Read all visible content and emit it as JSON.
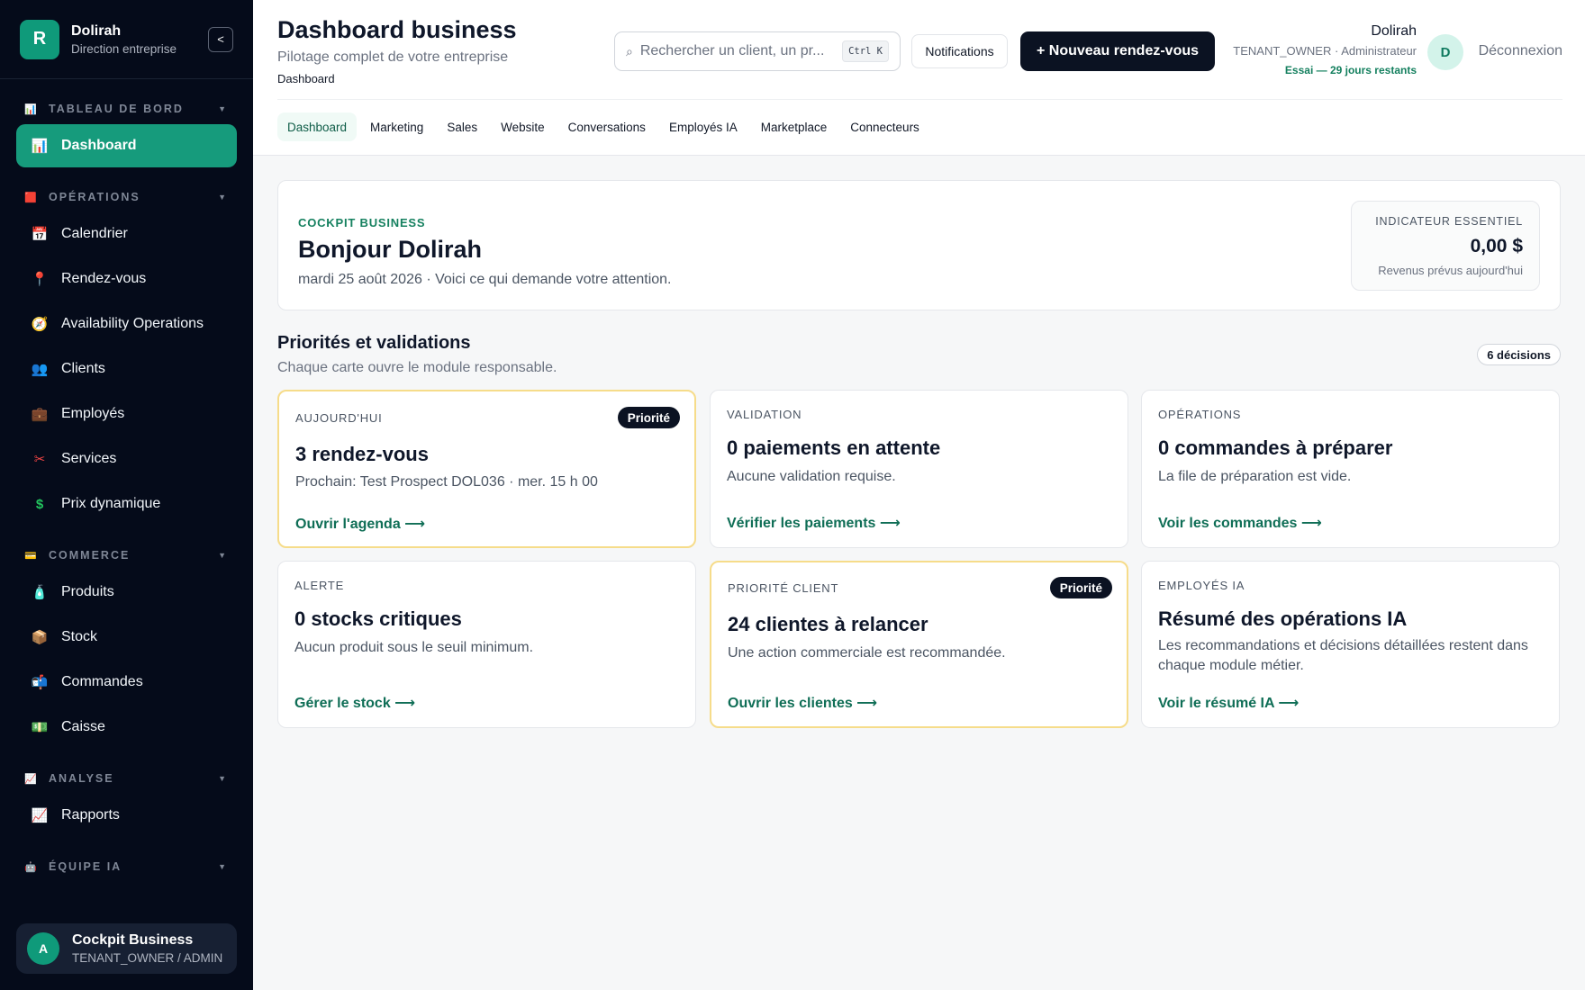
{
  "sidebar": {
    "brand": {
      "initial": "R",
      "name": "Dolirah",
      "subtitle": "Direction entreprise",
      "collapse": "<"
    },
    "sections": {
      "tableau": {
        "label": "TABLEAU DE BORD",
        "icon": "📊"
      },
      "operations": {
        "label": "OPÉRATIONS",
        "icon": "🟥"
      },
      "commerce": {
        "label": "COMMERCE",
        "icon": "💳"
      },
      "analyse": {
        "label": "ANALYSE",
        "icon": "📈"
      },
      "equipe": {
        "label": "ÉQUIPE IA",
        "icon": "🤖"
      }
    },
    "items": [
      {
        "label": "Dashboard",
        "icon": "📊"
      },
      {
        "label": "Calendrier",
        "icon": "📅"
      },
      {
        "label": "Rendez-vous",
        "icon": "📍"
      },
      {
        "label": "Availability Operations",
        "icon": "🧭"
      },
      {
        "label": "Clients",
        "icon": "👥"
      },
      {
        "label": "Employés",
        "icon": "💼"
      },
      {
        "label": "Services",
        "icon": "✂"
      },
      {
        "label": "Prix dynamique",
        "icon": "$"
      },
      {
        "label": "Produits",
        "icon": "🧴"
      },
      {
        "label": "Stock",
        "icon": "📦"
      },
      {
        "label": "Commandes",
        "icon": "📬"
      },
      {
        "label": "Caisse",
        "icon": "💵"
      },
      {
        "label": "Rapports",
        "icon": "📈"
      }
    ],
    "user": {
      "initial": "A",
      "name": "Cockpit Business",
      "role": "TENANT_OWNER / ADMIN"
    }
  },
  "header": {
    "title": "Dashboard business",
    "subtitle": "Pilotage complet de votre entreprise",
    "breadcrumb": "Dashboard",
    "search_placeholder": "Rechercher un client, un pr...",
    "search_shortcut": "Ctrl K",
    "notifications": "Notifications",
    "new_appointment": "+ Nouveau rendez-vous",
    "account": {
      "name": "Dolirah",
      "role": "TENANT_OWNER · Administrateur",
      "trial": "Essai — 29 jours restants",
      "initial": "D"
    },
    "logout": "Déconnexion",
    "tabs": [
      "Dashboard",
      "Marketing",
      "Sales",
      "Website",
      "Conversations",
      "Employés IA",
      "Marketplace",
      "Connecteurs"
    ]
  },
  "hero": {
    "tag": "COCKPIT BUSINESS",
    "title": "Bonjour Dolirah",
    "subtitle": "mardi 25 août 2026 · Voici ce qui demande votre attention.",
    "kpi": {
      "label": "INDICATEUR ESSENTIEL",
      "value": "0,00 $",
      "sub": "Revenus prévus aujourd'hui"
    }
  },
  "priorities": {
    "title": "Priorités et validations",
    "subtitle": "Chaque carte ouvre le module responsable.",
    "count": "6 décisions",
    "cards": [
      {
        "eyebrow": "AUJOURD'HUI",
        "badge": "Priorité",
        "title": "3 rendez-vous",
        "desc": "Prochain: Test Prospect DOL036 · mer. 15 h 00",
        "link": "Ouvrir l'agenda ⟶"
      },
      {
        "eyebrow": "VALIDATION",
        "title": "0 paiements en attente",
        "desc": "Aucune validation requise.",
        "link": "Vérifier les paiements ⟶"
      },
      {
        "eyebrow": "OPÉRATIONS",
        "title": "0 commandes à préparer",
        "desc": "La file de préparation est vide.",
        "link": "Voir les commandes ⟶"
      },
      {
        "eyebrow": "ALERTE",
        "title": "0 stocks critiques",
        "desc": "Aucun produit sous le seuil minimum.",
        "link": "Gérer le stock ⟶"
      },
      {
        "eyebrow": "PRIORITÉ CLIENT",
        "badge": "Priorité",
        "title": "24 clientes à relancer",
        "desc": "Une action commerciale est recommandée.",
        "link": "Ouvrir les clientes ⟶"
      },
      {
        "eyebrow": "EMPLOYÉS IA",
        "title": "Résumé des opérations IA",
        "desc": "Les recommandations et décisions détaillées restent dans chaque module métier.",
        "link": "Voir le résumé IA ⟶"
      }
    ]
  }
}
